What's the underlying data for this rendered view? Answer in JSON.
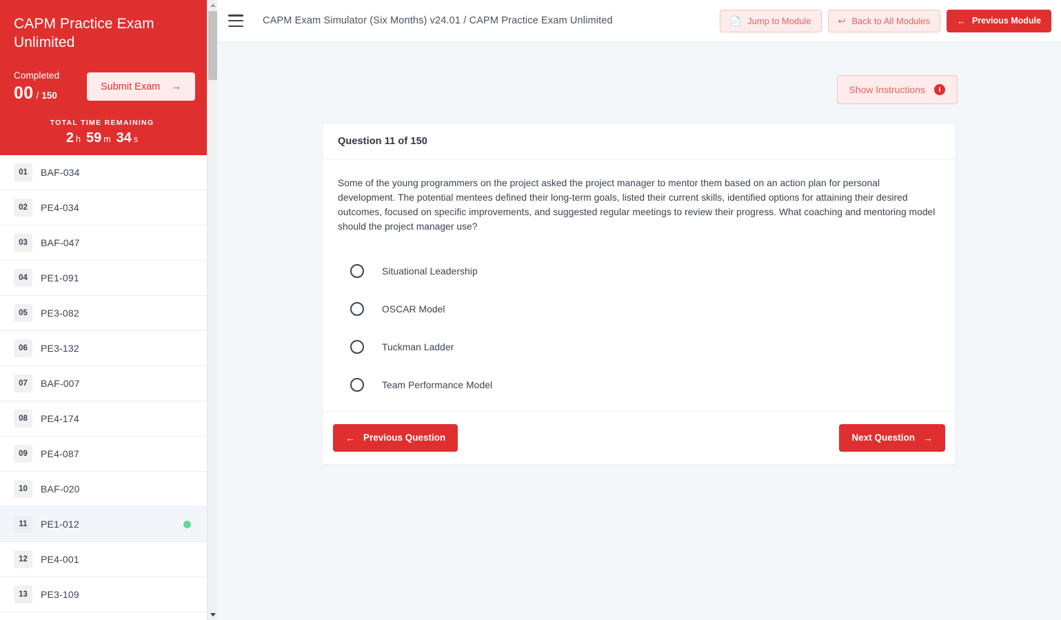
{
  "sidebar": {
    "title": "CAPM Practice Exam Unlimited",
    "completed_label": "Completed",
    "completed_count": "00",
    "completed_sep": "/",
    "completed_total": "150",
    "submit_label": "Submit Exam",
    "submit_icon": "arrow-right-icon",
    "timer_label": "TOTAL TIME REMAINING",
    "timer": {
      "hours": "2",
      "hours_unit": "h",
      "minutes": "59",
      "minutes_unit": "m",
      "seconds": "34",
      "seconds_unit": "s"
    },
    "questions": [
      {
        "num": "01",
        "code": "BAF-034",
        "active": false,
        "answered": false
      },
      {
        "num": "02",
        "code": "PE4-034",
        "active": false,
        "answered": false
      },
      {
        "num": "03",
        "code": "BAF-047",
        "active": false,
        "answered": false
      },
      {
        "num": "04",
        "code": "PE1-091",
        "active": false,
        "answered": false
      },
      {
        "num": "05",
        "code": "PE3-082",
        "active": false,
        "answered": false
      },
      {
        "num": "06",
        "code": "PE3-132",
        "active": false,
        "answered": false
      },
      {
        "num": "07",
        "code": "BAF-007",
        "active": false,
        "answered": false
      },
      {
        "num": "08",
        "code": "PE4-174",
        "active": false,
        "answered": false
      },
      {
        "num": "09",
        "code": "PE4-087",
        "active": false,
        "answered": false
      },
      {
        "num": "10",
        "code": "BAF-020",
        "active": false,
        "answered": false
      },
      {
        "num": "11",
        "code": "PE1-012",
        "active": true,
        "answered": true
      },
      {
        "num": "12",
        "code": "PE4-001",
        "active": false,
        "answered": false
      },
      {
        "num": "13",
        "code": "PE3-109",
        "active": false,
        "answered": false
      }
    ]
  },
  "topbar": {
    "menu_icon": "hamburger-menu-icon",
    "breadcrumb": "CAPM Exam Simulator (Six Months) v24.01 / CAPM Practice Exam Unlimited",
    "buttons": [
      {
        "label": "Jump to Module",
        "icon": "external-link-icon",
        "style": "outline"
      },
      {
        "label": "Back to All Modules",
        "icon": "reply-arrow-icon",
        "style": "outline"
      },
      {
        "label": "Previous Module",
        "icon": "arrow-left-icon",
        "style": "solid"
      }
    ]
  },
  "main": {
    "instructions_label": "Show Instructions",
    "instructions_badge": "i",
    "question_header": "Question 11 of 150",
    "question_text": "Some of the young programmers on the project asked the project manager to mentor them based on an action plan for personal development. The potential mentees defined their long-term goals, listed their current skills, identified options for attaining their desired outcomes, focused on specific improvements, and suggested regular meetings to review their progress. What coaching and mentoring model should the project manager use?",
    "options": [
      {
        "label": "Situational Leadership",
        "selected": false
      },
      {
        "label": "OSCAR Model",
        "selected": false
      },
      {
        "label": "Tuckman Ladder",
        "selected": false
      },
      {
        "label": "Team Performance Model",
        "selected": false
      }
    ],
    "prev_label": "Previous Question",
    "next_label": "Next Question"
  },
  "colors": {
    "brand_red": "#e02f2f",
    "soft_red_bg": "#fdeceb",
    "answered_green": "#5fd99a",
    "page_bg": "#f4f7fa"
  }
}
